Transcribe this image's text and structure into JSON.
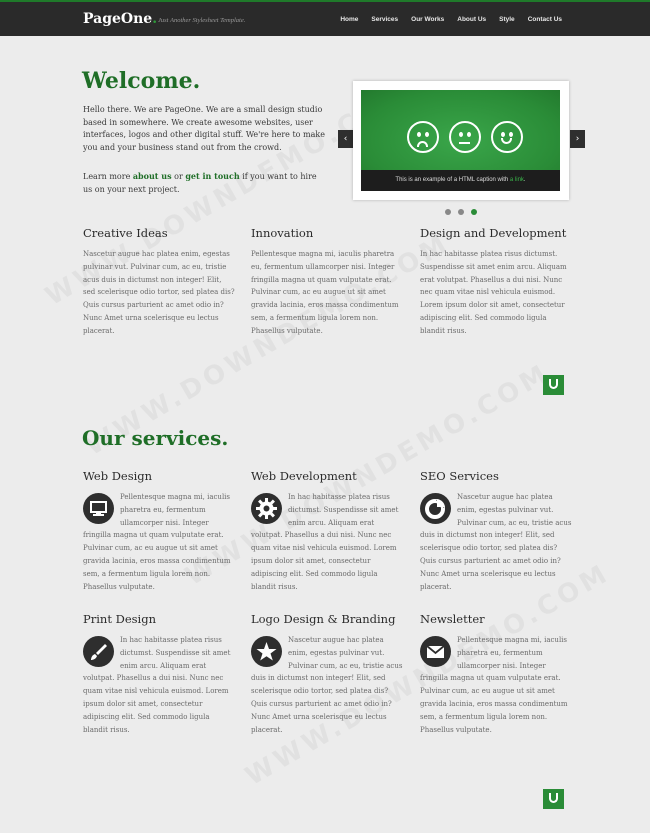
{
  "header": {
    "logo": "PageOne",
    "logo_dot": ".",
    "tagline": "Just Another Stylesheet Template.",
    "nav": [
      "Home",
      "Services",
      "Our Works",
      "About Us",
      "Style",
      "Contact Us"
    ]
  },
  "welcome": {
    "title": "Welcome.",
    "intro": "Hello there. We are PageOne. We are a small design studio based in somewhere. We create awesome websites, user interfaces, logos and other digital stuff. We're here to make you and your business stand out from the crowd.",
    "learn_pre": "Learn more ",
    "about_link": "about us",
    "learn_mid": " or ",
    "touch_link": "get in touch",
    "learn_post": " if you want to hire us on your next project."
  },
  "slider": {
    "caption_pre": "This is an example of a HTML caption with ",
    "caption_link": "a link",
    "caption_post": ".",
    "prev": "‹",
    "next": "›",
    "dots": 3,
    "active_dot": 3
  },
  "features": [
    {
      "title": "Creative Ideas",
      "text": "Nascetur augue hac platea enim, egestas pulvinar vut. Pulvinar cum, ac eu, tristie acus duis in dictumst non integer! Elit, sed scelerisque odio tortor, sed platea dis? Quis cursus parturient ac amet odio in? Nunc Amet urna scelerisque eu lectus placerat."
    },
    {
      "title": "Innovation",
      "text": "Pellentesque magna mi, iaculis pharetra eu, fermentum ullamcorper nisi. Integer fringilla magna ut quam vulputate erat. Pulvinar cum, ac eu augue ut sit amet gravida lacinia, eros massa condimentum sem, a fermentum ligula lorem non. Phasellus vulputate."
    },
    {
      "title": "Design and Development",
      "text": "In hac habitasse platea risus dictumst. Suspendisse sit amet enim arcu. Aliquam erat volutpat. Phasellus a dui nisi. Nunc nec quam vitae nisl vehicula euismod. Lorem ipsum dolor sit amet, consectetur adipiscing elit. Sed commodo ligula blandit risus."
    }
  ],
  "services_title": "Our services.",
  "services": [
    {
      "title": "Web Design",
      "icon": "monitor-icon",
      "text": "Pellentesque magna mi, iaculis pharetra eu, fermentum ullamcorper nisi. Integer fringilla magna ut quam vulputate erat. Pulvinar cum, ac eu augue ut sit amet gravida lacinia, eros massa condimentum sem, a fermentum ligula lorem non. Phasellus vulputate."
    },
    {
      "title": "Web Development",
      "icon": "gear-icon",
      "text": "In hac habitasse platea risus dictumst. Suspendisse sit amet enim arcu. Aliquam erat volutpat. Phasellus a dui nisi. Nunc nec quam vitae nisl vehicula euismod. Lorem ipsum dolor sit amet, consectetur adipiscing elit. Sed commodo ligula blandit risus."
    },
    {
      "title": "SEO Services",
      "icon": "pie-chart-icon",
      "text": "Nascetur augue hac platea enim, egestas pulvinar vut. Pulvinar cum, ac eu, tristie acus duis in dictumst non integer! Elit, sed scelerisque odio tortor, sed platea dis? Quis cursus parturient ac amet odio in? Nunc Amet urna scelerisque eu lectus placerat."
    },
    {
      "title": "Print Design",
      "icon": "brush-icon",
      "text": "In hac habitasse platea risus dictumst. Suspendisse sit amet enim arcu. Aliquam erat volutpat. Phasellus a dui nisi. Nunc nec quam vitae nisl vehicula euismod. Lorem ipsum dolor sit amet, consectetur adipiscing elit. Sed commodo ligula blandit risus."
    },
    {
      "title": "Logo Design & Branding",
      "icon": "star-icon",
      "text": "Nascetur augue hac platea enim, egestas pulvinar vut. Pulvinar cum, ac eu, tristie acus duis in dictumst non integer! Elit, sed scelerisque odio tortor, sed platea dis? Quis cursus parturient ac amet odio in? Nunc Amet urna scelerisque eu lectus placerat."
    },
    {
      "title": "Newsletter",
      "icon": "envelope-icon",
      "text": "Pellentesque magna mi, iaculis pharetra eu, fermentum ullamcorper nisi. Integer fringilla magna ut quam vulputate erat. Pulvinar cum, ac eu augue ut sit amet gravida lacinia, eros massa condimentum sem, a fermentum ligula lorem non. Phasellus vulputate."
    }
  ],
  "watermark": "WWW.DOWNDEMO.COM",
  "colors": {
    "accent": "#2a8c37",
    "heading_green": "#1f6e27",
    "topbar": "#2a2a2a",
    "background": "#ececec"
  }
}
